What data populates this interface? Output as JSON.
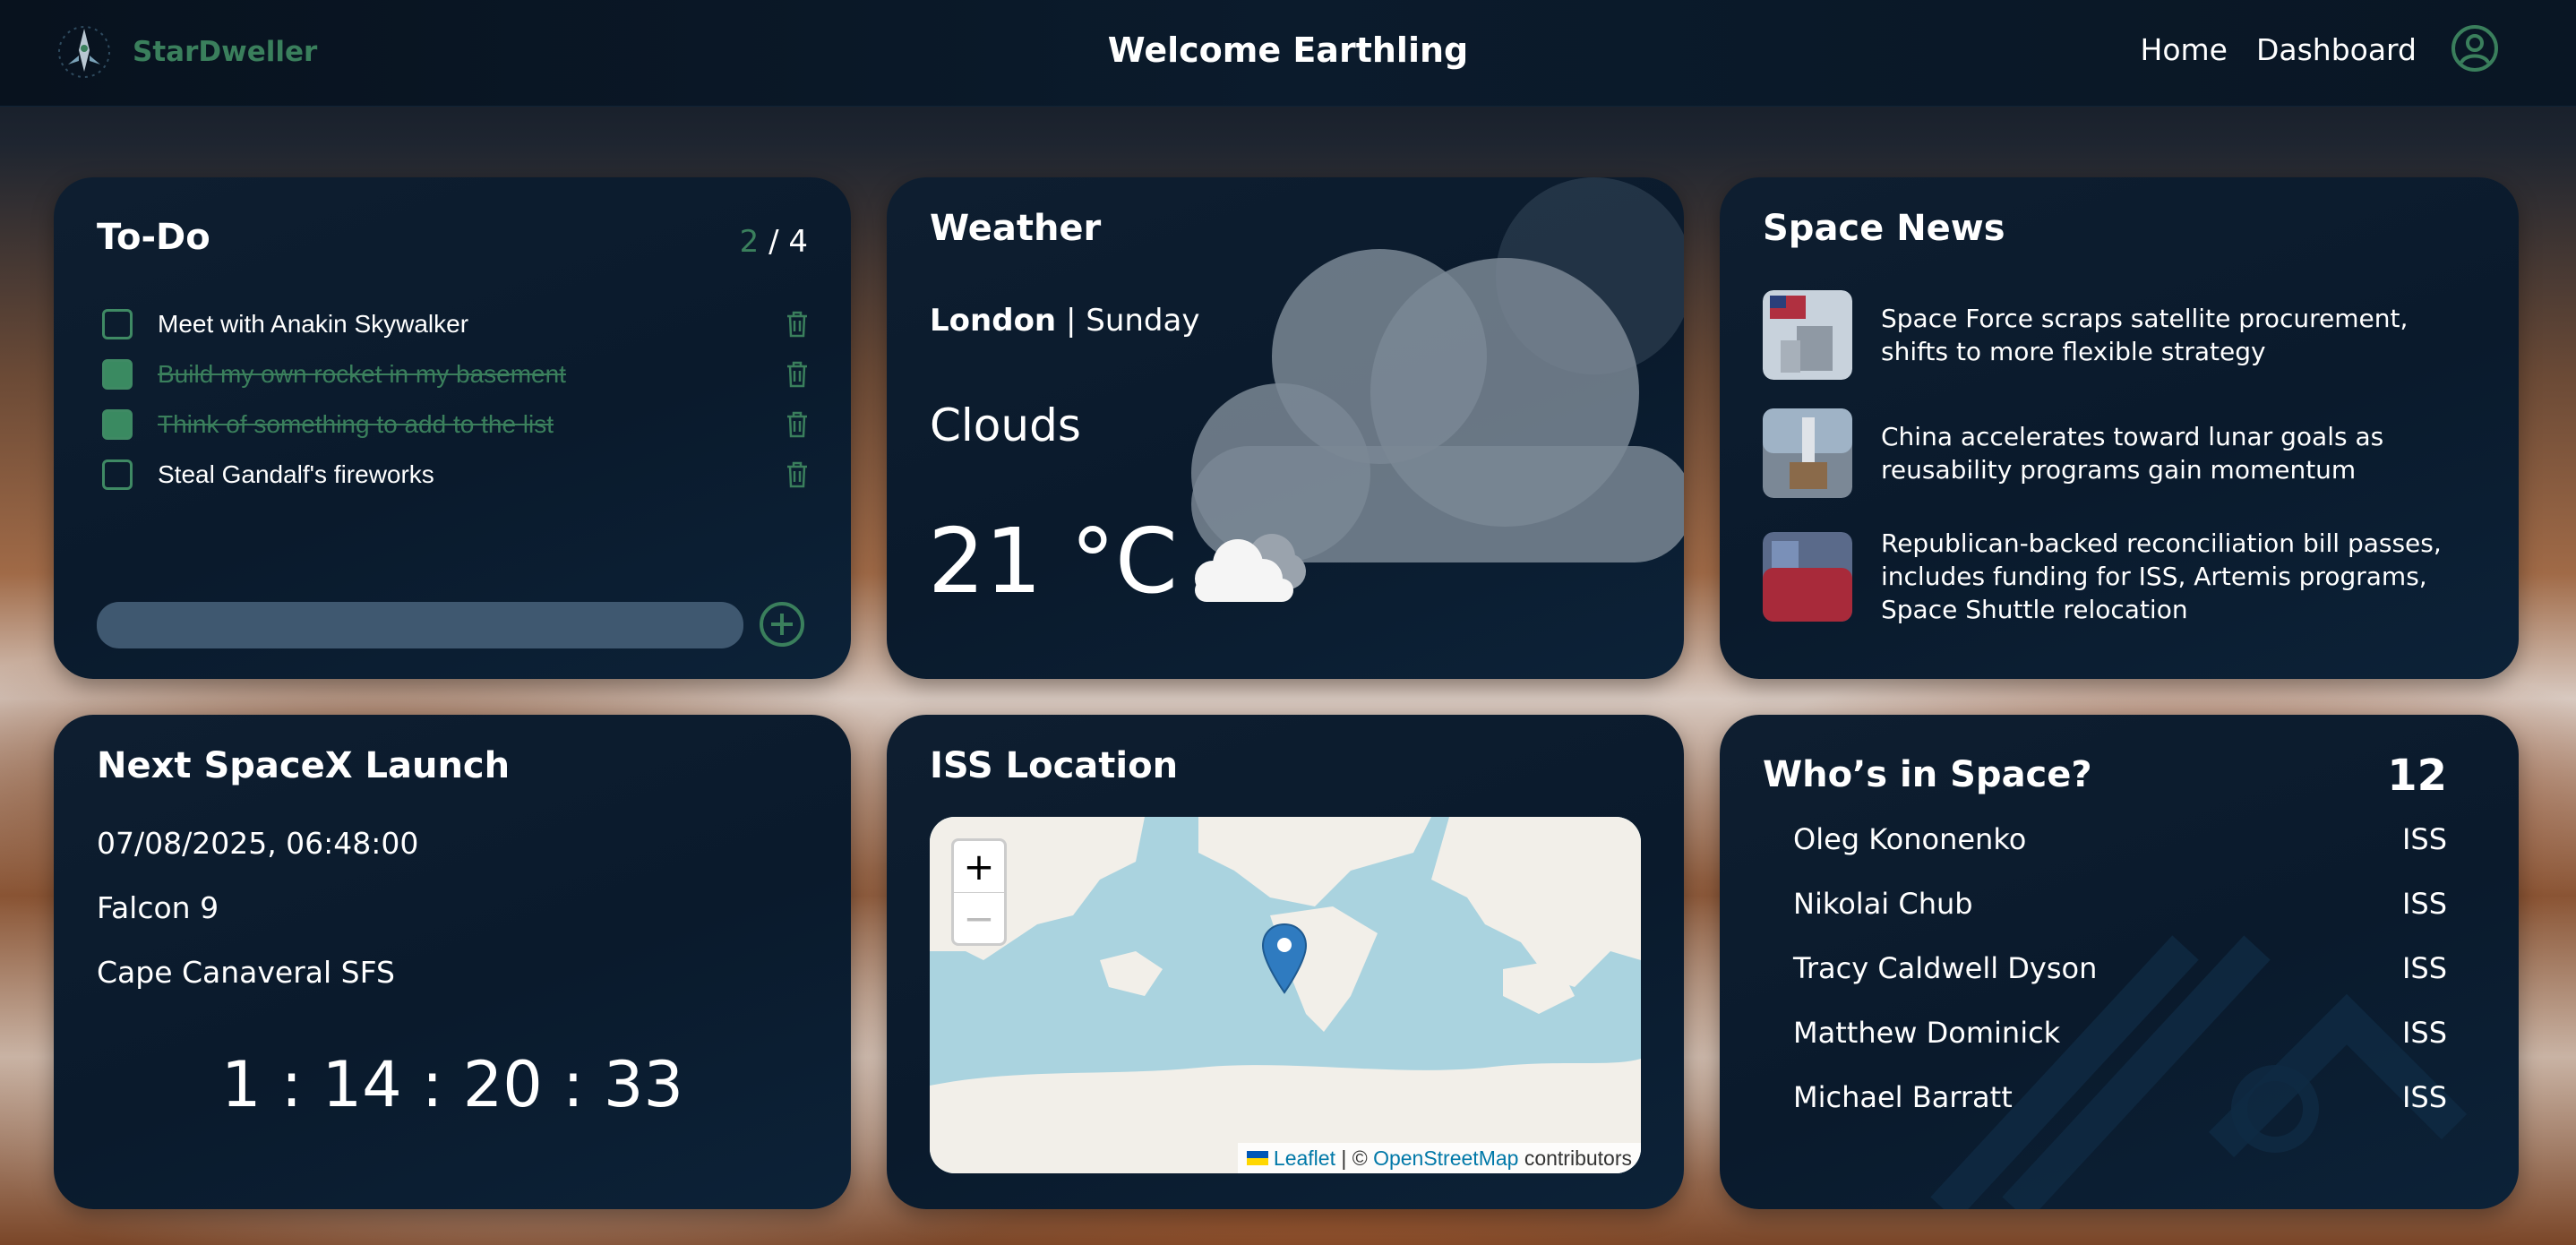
{
  "header": {
    "brand": "StarDweller",
    "title": "Welcome Earthling",
    "nav": [
      "Home",
      "Dashboard"
    ]
  },
  "todo": {
    "title": "To-Do",
    "done_count": "2",
    "total": "/ 4",
    "items": [
      {
        "text": "Meet with Anakin Skywalker",
        "done": false
      },
      {
        "text": "Build my own rocket in my basement",
        "done": true
      },
      {
        "text": "Think of something to add to the list",
        "done": true
      },
      {
        "text": "Steal Gandalf's fireworks",
        "done": false
      }
    ],
    "input_placeholder": ""
  },
  "weather": {
    "title": "Weather",
    "city": "London",
    "day": "Sunday",
    "separator": "|",
    "condition": "Clouds",
    "temperature": "21 °C"
  },
  "news": {
    "title": "Space News",
    "items": [
      {
        "text": "Space Force scraps satellite procurement, shifts to more flexible strategy",
        "thumb_color": "#8aa0b8"
      },
      {
        "text": "China accelerates toward lunar goals as reusability programs gain momentum",
        "thumb_color": "#6f7f90"
      },
      {
        "text": "Republican-backed reconciliation bill passes, includes funding for ISS, Artemis programs, Space Shuttle relocation",
        "thumb_color": "#a03040"
      }
    ]
  },
  "launch": {
    "title": "Next SpaceX Launch",
    "datetime": "07/08/2025, 06:48:00",
    "rocket": "Falcon 9",
    "site": "Cape Canaveral SFS",
    "countdown": "1 : 14 : 20 : 33"
  },
  "iss": {
    "title": "ISS Location",
    "zoom_in": "+",
    "zoom_out": "−",
    "attribution": {
      "leaflet": "Leaflet",
      "sep": " | © ",
      "osm": "OpenStreetMap",
      "tail": " contributors"
    }
  },
  "who": {
    "title": "Who’s in Space?",
    "count": "12",
    "crew": [
      {
        "name": "Oleg Kononenko",
        "craft": "ISS"
      },
      {
        "name": "Nikolai Chub",
        "craft": "ISS"
      },
      {
        "name": "Tracy Caldwell Dyson",
        "craft": "ISS"
      },
      {
        "name": "Matthew Dominick",
        "craft": "ISS"
      },
      {
        "name": "Michael Barratt",
        "craft": "ISS"
      }
    ]
  },
  "colors": {
    "accent": "#3a7f5c",
    "card": "#0e1e30",
    "header": "#0a1828"
  }
}
